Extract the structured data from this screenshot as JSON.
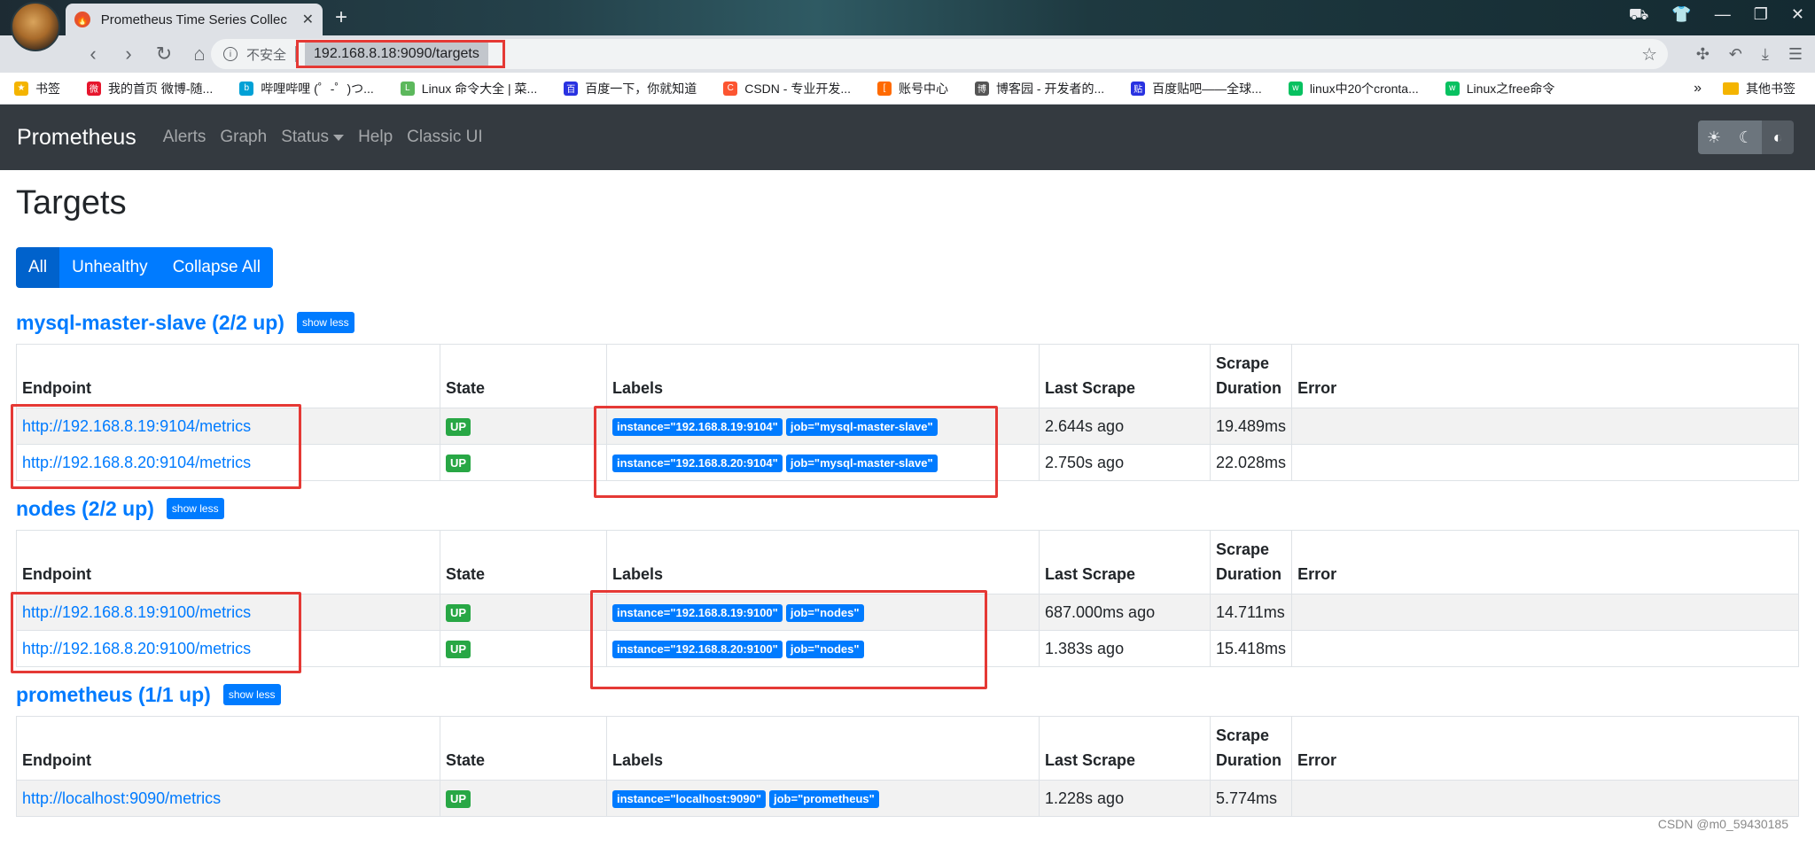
{
  "browser": {
    "tab_title": "Prometheus Time Series Collec",
    "tab_close": "✕",
    "new_tab": "+",
    "insecure_label": "不安全",
    "url": "192.168.8.18:9090/targets",
    "bookmarks": [
      {
        "label": "书签",
        "color": "#f4b400",
        "icon": "★"
      },
      {
        "label": "我的首页 微博-随...",
        "color": "#e6162d",
        "icon": "微"
      },
      {
        "label": "哔哩哔哩 (゜-゜)つ...",
        "color": "#00a1d6",
        "icon": "b"
      },
      {
        "label": "Linux 命令大全 | 菜...",
        "color": "#5cb85c",
        "icon": "L"
      },
      {
        "label": "百度一下，你就知道",
        "color": "#2932e1",
        "icon": "百"
      },
      {
        "label": "CSDN - 专业开发...",
        "color": "#fc5531",
        "icon": "C"
      },
      {
        "label": "账号中心",
        "color": "#ff6a00",
        "icon": "["
      },
      {
        "label": "博客园 - 开发者的...",
        "color": "#555555",
        "icon": "博"
      },
      {
        "label": "百度贴吧——全球...",
        "color": "#2932e1",
        "icon": "贴"
      },
      {
        "label": "linux中20个cronta...",
        "color": "#07c160",
        "icon": "w"
      },
      {
        "label": "Linux之free命令",
        "color": "#07c160",
        "icon": "w"
      }
    ],
    "bookmarks_more": "»",
    "other_bookmarks": "其他书签"
  },
  "navbar": {
    "brand": "Prometheus",
    "links": [
      "Alerts",
      "Graph",
      "Status",
      "Help",
      "Classic UI"
    ]
  },
  "page": {
    "title": "Targets",
    "filters": [
      "All",
      "Unhealthy",
      "Collapse All"
    ]
  },
  "table_headers": {
    "endpoint": "Endpoint",
    "state": "State",
    "labels": "Labels",
    "last_scrape": "Last Scrape",
    "scrape_duration_1": "Scrape",
    "scrape_duration_2": "Duration",
    "error": "Error"
  },
  "pools": [
    {
      "title": "mysql-master-slave (2/2 up)",
      "toggle": "show less",
      "rows": [
        {
          "endpoint": "http://192.168.8.19:9104/metrics",
          "state": "UP",
          "labels": [
            "instance=\"192.168.8.19:9104\"",
            "job=\"mysql-master-slave\""
          ],
          "last_scrape": "2.644s ago",
          "duration": "19.489ms",
          "error": ""
        },
        {
          "endpoint": "http://192.168.8.20:9104/metrics",
          "state": "UP",
          "labels": [
            "instance=\"192.168.8.20:9104\"",
            "job=\"mysql-master-slave\""
          ],
          "last_scrape": "2.750s ago",
          "duration": "22.028ms",
          "error": ""
        }
      ]
    },
    {
      "title": "nodes (2/2 up)",
      "toggle": "show less",
      "rows": [
        {
          "endpoint": "http://192.168.8.19:9100/metrics",
          "state": "UP",
          "labels": [
            "instance=\"192.168.8.19:9100\"",
            "job=\"nodes\""
          ],
          "last_scrape": "687.000ms ago",
          "duration": "14.711ms",
          "error": ""
        },
        {
          "endpoint": "http://192.168.8.20:9100/metrics",
          "state": "UP",
          "labels": [
            "instance=\"192.168.8.20:9100\"",
            "job=\"nodes\""
          ],
          "last_scrape": "1.383s ago",
          "duration": "15.418ms",
          "error": ""
        }
      ]
    },
    {
      "title": "prometheus (1/1 up)",
      "toggle": "show less",
      "rows": [
        {
          "endpoint": "http://localhost:9090/metrics",
          "state": "UP",
          "labels": [
            "instance=\"localhost:9090\"",
            "job=\"prometheus\""
          ],
          "last_scrape": "1.228s ago",
          "duration": "5.774ms",
          "error": ""
        }
      ]
    }
  ],
  "watermark": "CSDN @m0_59430185",
  "colors": {
    "primary": "#007bff",
    "up": "#28a745",
    "navbar": "#343a40",
    "annotation": "#e53935"
  }
}
